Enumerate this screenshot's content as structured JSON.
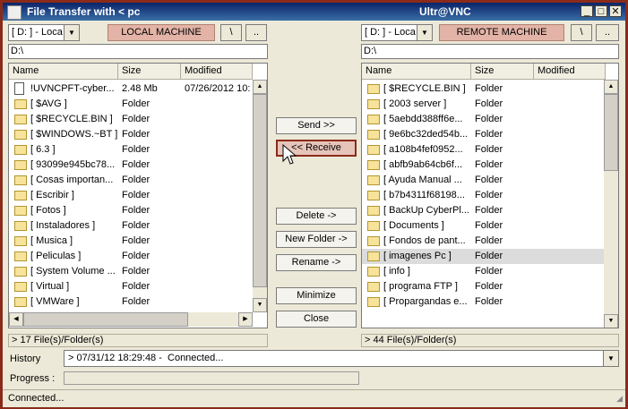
{
  "window": {
    "title_left": "File Transfer with < pc",
    "title_right": "Ultr@VNC",
    "minimize_glyph": "_",
    "maximize_glyph": "□",
    "close_glyph": "✕"
  },
  "local": {
    "drive": "[ D: ] - Loca",
    "machine_label": "LOCAL MACHINE",
    "root_label": "\\",
    "up_label": "..",
    "path": "D:\\",
    "columns": [
      "Name",
      "Size",
      "Modified"
    ],
    "rows": [
      {
        "name": "!UVNCPFT-cyber...",
        "size": "2.48 Mb",
        "modified": "07/26/2012 10:",
        "type": "file"
      },
      {
        "name": "[ $AVG ]",
        "size": "Folder",
        "modified": "",
        "type": "folder"
      },
      {
        "name": "[ $RECYCLE.BIN ]",
        "size": "Folder",
        "modified": "",
        "type": "folder"
      },
      {
        "name": "[ $WINDOWS.~BT ]",
        "size": "Folder",
        "modified": "",
        "type": "folder"
      },
      {
        "name": "[ 6.3 ]",
        "size": "Folder",
        "modified": "",
        "type": "folder"
      },
      {
        "name": "[ 93099e945bc78...",
        "size": "Folder",
        "modified": "",
        "type": "folder"
      },
      {
        "name": "[ Cosas importan...",
        "size": "Folder",
        "modified": "",
        "type": "folder"
      },
      {
        "name": "[ Escribir ]",
        "size": "Folder",
        "modified": "",
        "type": "folder"
      },
      {
        "name": "[ Fotos ]",
        "size": "Folder",
        "modified": "",
        "type": "folder"
      },
      {
        "name": "[ Instaladores ]",
        "size": "Folder",
        "modified": "",
        "type": "folder"
      },
      {
        "name": "[ Musica ]",
        "size": "Folder",
        "modified": "",
        "type": "folder"
      },
      {
        "name": "[ Peliculas ]",
        "size": "Folder",
        "modified": "",
        "type": "folder"
      },
      {
        "name": "[ System Volume ...",
        "size": "Folder",
        "modified": "",
        "type": "folder"
      },
      {
        "name": "[ Virtual ]",
        "size": "Folder",
        "modified": "",
        "type": "folder"
      },
      {
        "name": "[ VMWare ]",
        "size": "Folder",
        "modified": "",
        "type": "folder"
      }
    ],
    "status": "> 17 File(s)/Folder(s)"
  },
  "remote": {
    "drive": "[ D: ] - Loca",
    "machine_label": "REMOTE MACHINE",
    "root_label": "\\",
    "up_label": "..",
    "path": "D:\\",
    "columns": [
      "Name",
      "Size",
      "Modified"
    ],
    "rows": [
      {
        "name": "[ $RECYCLE.BIN ]",
        "size": "Folder",
        "modified": "",
        "type": "folder"
      },
      {
        "name": "[ 2003 server ]",
        "size": "Folder",
        "modified": "",
        "type": "folder"
      },
      {
        "name": "[ 5aebdd388ff6e...",
        "size": "Folder",
        "modified": "",
        "type": "folder"
      },
      {
        "name": "[ 9e6bc32ded54b...",
        "size": "Folder",
        "modified": "",
        "type": "folder"
      },
      {
        "name": "[ a108b4fef0952...",
        "size": "Folder",
        "modified": "",
        "type": "folder"
      },
      {
        "name": "[ abfb9ab64cb6f...",
        "size": "Folder",
        "modified": "",
        "type": "folder"
      },
      {
        "name": "[ Ayuda Manual ...",
        "size": "Folder",
        "modified": "",
        "type": "folder"
      },
      {
        "name": "[ b7b4311f68198...",
        "size": "Folder",
        "modified": "",
        "type": "folder"
      },
      {
        "name": "[ BackUp CyberPl...",
        "size": "Folder",
        "modified": "",
        "type": "folder"
      },
      {
        "name": "[ Documents ]",
        "size": "Folder",
        "modified": "",
        "type": "folder"
      },
      {
        "name": "[ Fondos de pant...",
        "size": "Folder",
        "modified": "",
        "type": "folder"
      },
      {
        "name": "[ imagenes Pc ]",
        "size": "Folder",
        "modified": "",
        "type": "folder",
        "selected": true
      },
      {
        "name": "[ info ]",
        "size": "Folder",
        "modified": "",
        "type": "folder"
      },
      {
        "name": "[ programa FTP ]",
        "size": "Folder",
        "modified": "",
        "type": "folder"
      },
      {
        "name": "[ Propargandas e...",
        "size": "Folder",
        "modified": "",
        "type": "folder"
      }
    ],
    "status": "> 44 File(s)/Folder(s)"
  },
  "actions": {
    "send": "Send >>",
    "receive": "<< Receive",
    "delete": "Delete ->",
    "new_folder": "New Folder ->",
    "rename": "Rename ->",
    "minimize": "Minimize",
    "close": "Close"
  },
  "history": {
    "label": "History",
    "value": "> 07/31/12 18:29:48 -  Connected..."
  },
  "progress": {
    "label": "Progress :"
  },
  "statusbar": {
    "text": "Connected..."
  }
}
